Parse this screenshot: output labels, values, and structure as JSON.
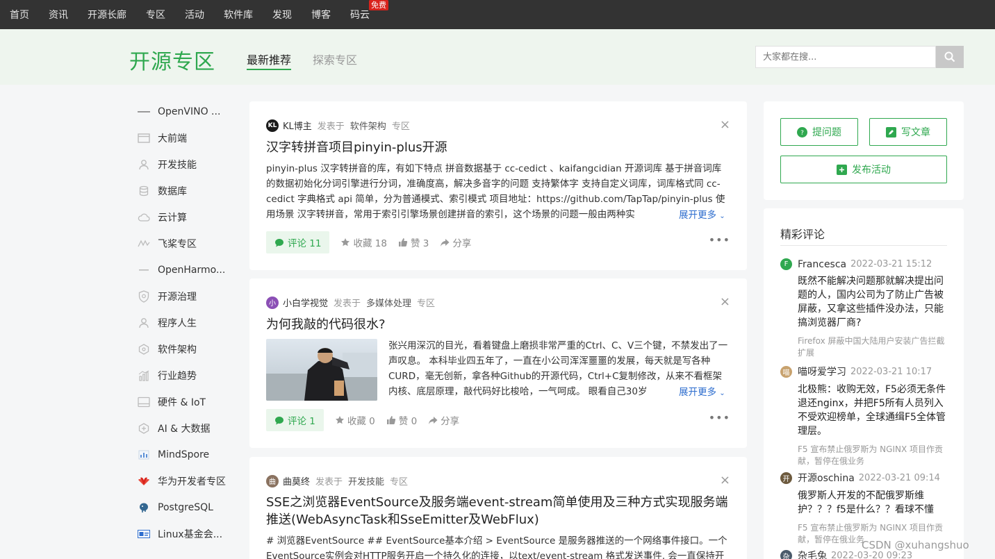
{
  "topnav": {
    "items": [
      "首页",
      "资讯",
      "开源长廊",
      "专区",
      "活动",
      "软件库",
      "发现",
      "博客",
      "码云"
    ],
    "badge": "免费"
  },
  "header": {
    "title": "开源专区",
    "tabs": [
      "最新推荐",
      "探索专区"
    ],
    "search_placeholder": "大家都在搜..."
  },
  "sidebar": {
    "items": [
      {
        "label": "OpenVINO ...",
        "icon": "openvino-icon"
      },
      {
        "label": "大前端",
        "icon": "browser-window-icon"
      },
      {
        "label": "开发技能",
        "icon": "person-icon"
      },
      {
        "label": "数据库",
        "icon": "database-icon"
      },
      {
        "label": "云计算",
        "icon": "cloud-icon"
      },
      {
        "label": "飞桨专区",
        "icon": "paddle-icon"
      },
      {
        "label": "OpenHarmo...",
        "icon": "openharmony-icon"
      },
      {
        "label": "开源治理",
        "icon": "shield-icon"
      },
      {
        "label": "程序人生",
        "icon": "person-icon"
      },
      {
        "label": "软件架构",
        "icon": "architecture-icon"
      },
      {
        "label": "行业趋势",
        "icon": "bar-chart-icon"
      },
      {
        "label": "硬件 & IoT",
        "icon": "hardware-icon"
      },
      {
        "label": "AI & 大数据",
        "icon": "ai-icon"
      },
      {
        "label": "MindSpore",
        "icon": "mindspore-icon"
      },
      {
        "label": "华为开发者专区",
        "icon": "huawei-icon"
      },
      {
        "label": "PostgreSQL",
        "icon": "postgresql-icon"
      },
      {
        "label": "Linux基金会...",
        "icon": "linux-foundation-icon"
      }
    ]
  },
  "feed": [
    {
      "author": "KL博主",
      "avatar_text": "KL",
      "posted_in": "发表于",
      "category": "软件架构",
      "zone": "专区",
      "title": "汉字转拼音项目pinyin-plus开源",
      "excerpt": "pinyin-plus 汉字转拼音的库，有如下特点 拼音数据基于 cc-cedict 、kaifangcidian 开源词库 基于拼音词库的数据初始化分词引擎进行分词，准确度高，解决多音字的问题 支持繁体字 支持自定义词库，词库格式同 cc-cedict 字典格式 api 简单，分为普通模式、索引模式 项目地址：https://github.com/TapTap/pinyin-plus 使用场景 汉字转拼音，常用于索引引擎场景创建拼音的索引，这个场景的问题一般由两种实",
      "more": "展开更多",
      "comments": "评论 11",
      "favorites": "收藏 18",
      "likes": "赞 3",
      "share": "分享"
    },
    {
      "author": "小白学视觉",
      "avatar_text": "小",
      "posted_in": "发表于",
      "category": "多媒体处理",
      "zone": "专区",
      "title": "为何我敲的代码很水?",
      "excerpt": "张兴用深沉的目光，看着键盘上磨损非常严重的Ctrl、C、V三个键，不禁发出了一声叹息。 本科毕业四五年了，一直在小公司浑浑噩噩的发展，每天就是写各种CURD，毫无创新，拿各种Github的开源代码，Ctrl+C复制修改，从来不看框架内核、底层原理，敲代码好比梭哈，一气呵成。 眼看自己30岁",
      "more": "展开更多",
      "comments": "评论 1",
      "favorites": "收藏 0",
      "likes": "赞 0",
      "share": "分享"
    },
    {
      "author": "曲莫终",
      "avatar_text": "曲",
      "posted_in": "发表于",
      "category": "开发技能",
      "zone": "专区",
      "title": "SSE之浏览器EventSource及服务端event-stream简单使用及三种方式实现服务端推送(WebAsyncTask和SseEmitter及WebFlux)",
      "excerpt": "# 浏览器EventSource ## EventSource基本介绍 > EventSource 是服务器推送的一个网络事件接口。一个EventSource实例会对HTTP服务开启一个持久化的连接，以text/event-stream 格式发送事件, 会一直保持开"
    }
  ],
  "actions_panel": {
    "ask": "提问题",
    "write": "写文章",
    "publish": "发布活动"
  },
  "comments_panel": {
    "title": "精彩评论",
    "items": [
      {
        "name": "Francesca",
        "avatar_text": "F",
        "time": "2022-03-21 15:12",
        "text": "既然不能解决问题那就解决提出问题的人，国内公司为了防止广告被屏蔽，又拿这些插件没办法，只能搞浏览器厂商?",
        "source": "Firefox 屏蔽中国大陆用户安装广告拦截扩展"
      },
      {
        "name": "喵呀爱学习",
        "avatar_text": "喵",
        "time": "2022-03-21 10:17",
        "text": "北极熊：收购无效，F5必须无条件退还nginx，并把F5所有人员列入不受欢迎榜单，全球通缉F5全体管理层。",
        "source": "F5 宣布禁止俄罗斯为 NGINX 项目作贡献，暂停在俄业务"
      },
      {
        "name": "开源oschina",
        "avatar_text": "开",
        "time": "2022-03-21 09:14",
        "text": "俄罗斯人开发的不配俄罗斯维护？？？f5是什么？？看球不懂",
        "source": "F5 宣布禁止俄罗斯为 NGINX 项目作贡献，暂停在俄业务"
      },
      {
        "name": "杂毛兔",
        "avatar_text": "杂",
        "time": "2022-03-20 09:23"
      }
    ]
  },
  "watermark": "CSDN @xuhangshuo",
  "colors": {
    "accent": "#2fa84f",
    "nav_bg": "#333333",
    "header_bg": "#eef5ee",
    "link": "#2d6dce"
  }
}
